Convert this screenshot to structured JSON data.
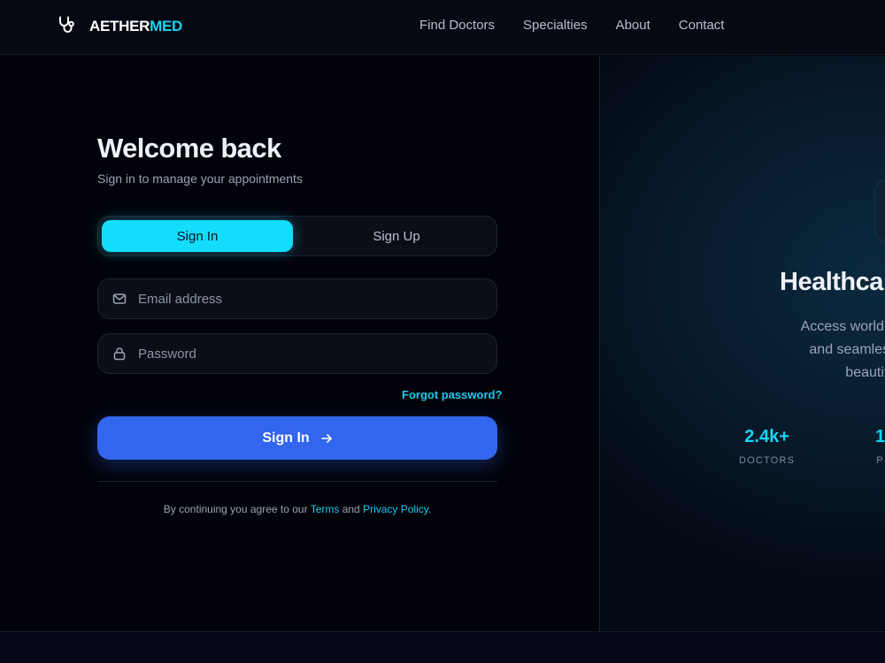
{
  "brand": {
    "name_primary": "AETHER",
    "name_accent": "MED",
    "icon": "stethoscope-icon"
  },
  "nav": {
    "items": [
      "Find Doctors",
      "Specialties",
      "About",
      "Contact"
    ]
  },
  "login": {
    "title": "Welcome back",
    "subtitle": "Sign in to manage your appointments",
    "tabs": {
      "signin": "Sign In",
      "signup": "Sign Up",
      "active": "signin"
    },
    "email": {
      "placeholder": "Email address",
      "value": "",
      "icon": "mail-icon"
    },
    "password": {
      "placeholder": "Password",
      "value": "",
      "icon": "lock-icon"
    },
    "forgot_label": "Forgot password?",
    "submit_label": "Sign In",
    "terms": {
      "prefix": "By continuing you agree to our ",
      "terms_link": "Terms",
      "middle": " and ",
      "privacy_link": "Privacy Policy",
      "suffix": "."
    }
  },
  "hero": {
    "title_visible": "Healthca",
    "desc_lines": [
      "Access world-class specia",
      "and seamless online co",
      "beautifully d"
    ],
    "stats": [
      {
        "value": "2.4k+",
        "label": "DOCTORS"
      },
      {
        "value": "1",
        "label": "P"
      }
    ]
  },
  "colors": {
    "accent": "#14dcfb",
    "primary": "#3366ee",
    "background": "#03040c"
  }
}
